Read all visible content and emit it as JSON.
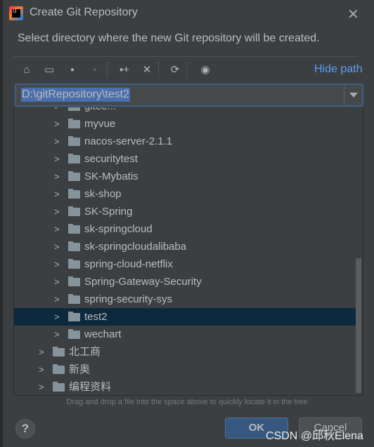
{
  "dialog": {
    "title": "Create Git Repository",
    "description": "Select directory where the new Git repository will be created.",
    "hide_path": "Hide path"
  },
  "toolbar": {
    "icons": [
      "home-icon",
      "desktop-icon",
      "project-folder-icon",
      "module-folder-icon",
      "new-folder-icon",
      "delete-icon",
      "refresh-icon",
      "show-hidden-icon"
    ]
  },
  "path": {
    "value": "D:\\gitRepository\\test2"
  },
  "tree": {
    "items": [
      {
        "label": "gitee...",
        "level": 2
      },
      {
        "label": "myvue",
        "level": 2
      },
      {
        "label": "nacos-server-2.1.1",
        "level": 2
      },
      {
        "label": "securitytest",
        "level": 2
      },
      {
        "label": "SK-Mybatis",
        "level": 2
      },
      {
        "label": "sk-shop",
        "level": 2
      },
      {
        "label": "SK-Spring",
        "level": 2
      },
      {
        "label": "sk-springcloud",
        "level": 2
      },
      {
        "label": "sk-springcloudalibaba",
        "level": 2
      },
      {
        "label": "spring-cloud-netflix",
        "level": 2
      },
      {
        "label": "Spring-Gateway-Security",
        "level": 2
      },
      {
        "label": "spring-security-sys",
        "level": 2
      },
      {
        "label": "test2",
        "level": 2,
        "selected": true
      },
      {
        "label": "wechart",
        "level": 2
      },
      {
        "label": "北工商",
        "level": 1
      },
      {
        "label": "新奥",
        "level": 1
      },
      {
        "label": "编程资料",
        "level": 1
      }
    ]
  },
  "hint": "Drag and drop a file into the space above to quickly locate it in the tree",
  "buttons": {
    "help": "?",
    "ok": "OK",
    "cancel": "Cancel"
  },
  "watermark": "CSDN @邱秋Elena",
  "colors": {
    "accent": "#589df6",
    "selection": "#0d293e",
    "ok": "#365880"
  }
}
